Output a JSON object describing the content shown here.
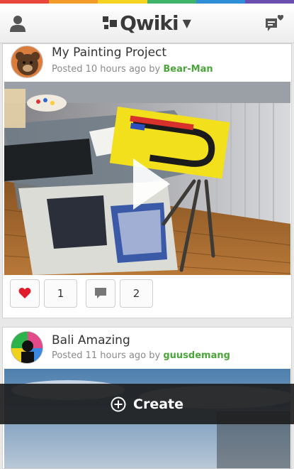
{
  "header": {
    "brand": "Qwiki",
    "stripe_colors": [
      "#e9473b",
      "#f39c2a",
      "#f4d21f",
      "#3fb36a",
      "#2e8fd6",
      "#6a4fb0"
    ]
  },
  "posts": [
    {
      "title": "My Painting Project",
      "posted_prefix": "Posted 10 hours ago by",
      "author": "Bear-Man",
      "likes": "1",
      "comments": "2"
    },
    {
      "title": "Bali Amazing",
      "posted_prefix": "Posted 11 hours ago by",
      "author": "guusdemang"
    }
  ],
  "create": {
    "label": "Create"
  },
  "colors": {
    "author": "#4aa63a",
    "like": "#e01b2a",
    "bar": "#1c1c1c"
  }
}
